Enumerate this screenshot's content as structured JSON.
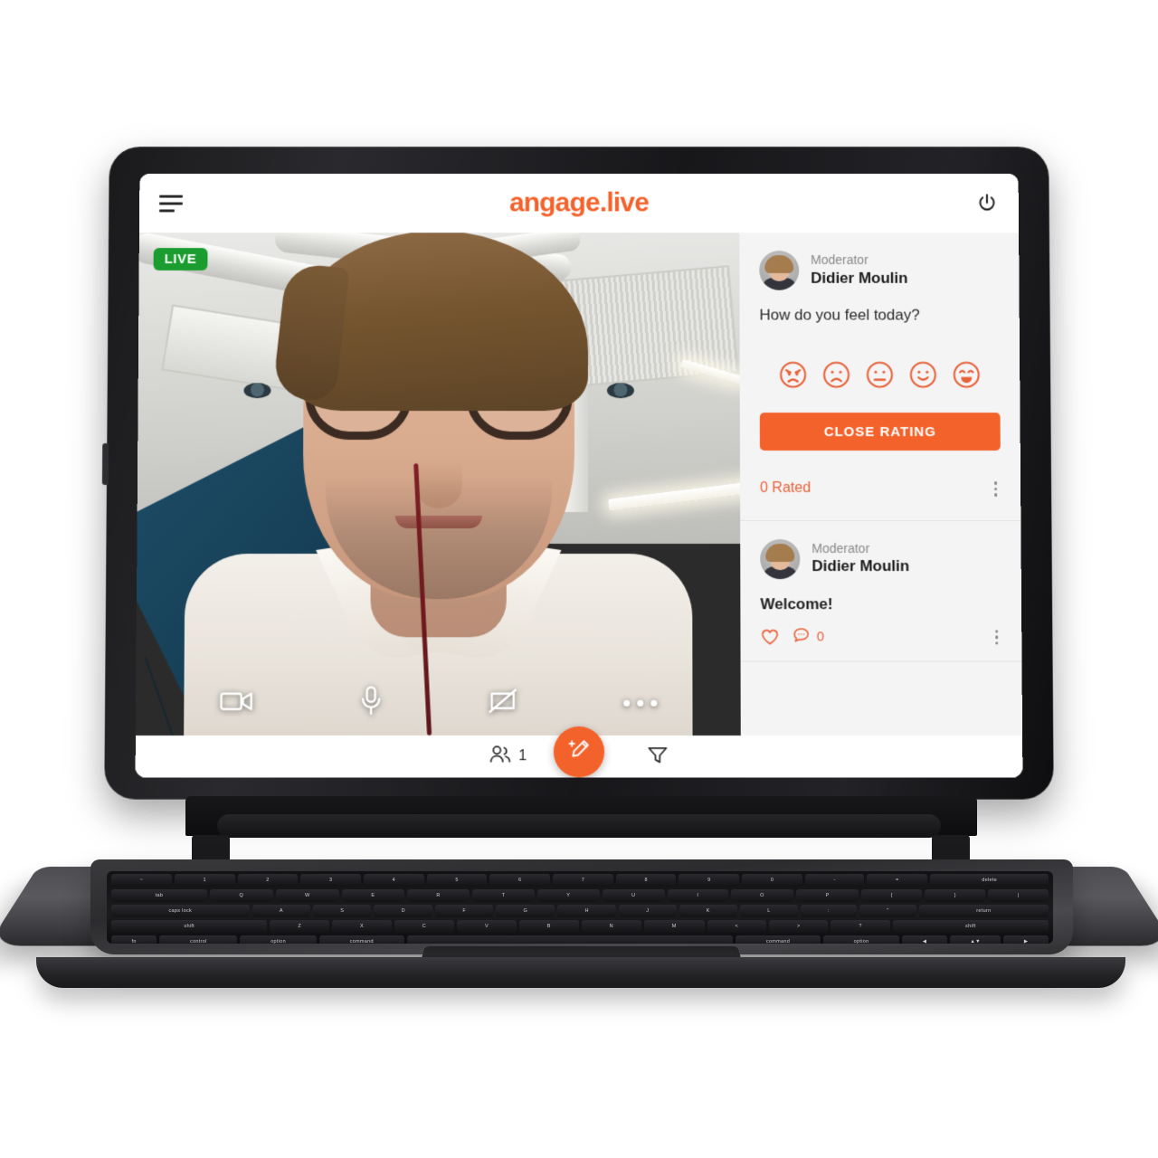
{
  "app": {
    "brand": "angage.live",
    "menu_icon": "hamburger-menu-icon",
    "power_icon": "power-icon"
  },
  "video": {
    "live_badge": "LIVE",
    "controls": [
      {
        "name": "camera-toggle",
        "icon": "video-camera-icon"
      },
      {
        "name": "microphone-toggle",
        "icon": "microphone-icon"
      },
      {
        "name": "screen-share-toggle",
        "icon": "screen-share-off-icon"
      },
      {
        "name": "more-options",
        "icon": "more-horizontal-icon"
      }
    ]
  },
  "sidebar": {
    "rating_card": {
      "role": "Moderator",
      "name": "Didier Moulin",
      "question": "How do you feel today?",
      "emojis": [
        "angry",
        "frowning",
        "neutral",
        "smiling",
        "laughing"
      ],
      "button_label": "CLOSE RATING",
      "rated_label": "0 Rated",
      "menu_icon": "kebab-menu-icon"
    },
    "post": {
      "role": "Moderator",
      "name": "Didier Moulin",
      "text": "Welcome!",
      "like_icon": "heart-icon",
      "comment_icon": "comment-icon",
      "comment_count": "0",
      "menu_icon": "kebab-menu-icon"
    }
  },
  "bottombar": {
    "participants_icon": "participants-icon",
    "participants_count": "1",
    "compose_icon": "compose-pencil-icon",
    "filter_icon": "filter-funnel-icon"
  },
  "keyboard": {
    "row1": [
      "~",
      "1",
      "2",
      "3",
      "4",
      "5",
      "6",
      "7",
      "8",
      "9",
      "0",
      "-",
      "=",
      "delete"
    ],
    "row2": [
      "tab",
      "Q",
      "W",
      "E",
      "R",
      "T",
      "Y",
      "U",
      "I",
      "O",
      "P",
      "{",
      "}",
      "|"
    ],
    "row3": [
      "caps lock",
      "A",
      "S",
      "D",
      "F",
      "G",
      "H",
      "J",
      "K",
      "L",
      ":",
      "\"",
      "return"
    ],
    "row4": [
      "shift",
      "Z",
      "X",
      "C",
      "V",
      "B",
      "N",
      "M",
      "<",
      ">",
      "?",
      "shift"
    ],
    "row5": [
      "fn",
      "control",
      "option",
      "command",
      "",
      "command",
      "option",
      "◀",
      "▲▼",
      "▶"
    ]
  },
  "colors": {
    "brand_orange": "#F4622B",
    "accent_orange": "#E8613A",
    "live_green": "#1a9d2e",
    "sidebar_bg": "#f4f4f4"
  }
}
